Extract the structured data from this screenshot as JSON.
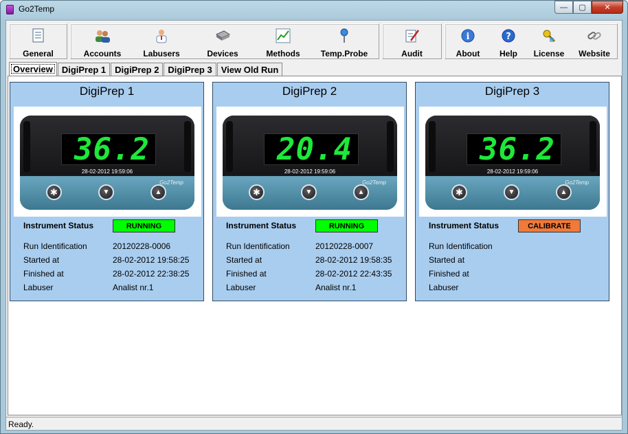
{
  "window": {
    "title": "Go2Temp"
  },
  "window_buttons": {
    "minimize": "—",
    "maximize": "▢",
    "close": "✕"
  },
  "toolbar": {
    "general": "General",
    "accounts": "Accounts",
    "labusers": "Labusers",
    "devices": "Devices",
    "methods": "Methods",
    "temp_probe": "Temp.Probe",
    "audit": "Audit",
    "about": "About",
    "help": "Help",
    "license": "License",
    "website": "Website"
  },
  "tabs": [
    "Overview",
    "DigiPrep 1",
    "DigiPrep 2",
    "DigiPrep 3",
    "View Old Run"
  ],
  "labels": {
    "instrument_status": "Instrument Status",
    "run_identification": "Run Identification",
    "started_at": "Started at",
    "finished_at": "Finished at",
    "labuser": "Labuser"
  },
  "panels": [
    {
      "title": "DigiPrep 1",
      "display_value": "36.2",
      "display_time": "28-02-2012 19:59:06",
      "brand": "Go2Temp",
      "status": "RUNNING",
      "status_color": "#00ff00",
      "run_id": "20120228-0006",
      "started": "28-02-2012 19:58:25",
      "finished": "28-02-2012 22:38:25",
      "labuser": "Analist nr.1"
    },
    {
      "title": "DigiPrep 2",
      "display_value": "20.4",
      "display_time": "28-02-2012 19:59:06",
      "brand": "Go2Temp",
      "status": "RUNNING",
      "status_color": "#00ff00",
      "run_id": "20120228-0007",
      "started": "28-02-2012 19:58:35",
      "finished": "28-02-2012 22:43:35",
      "labuser": "Analist nr.1"
    },
    {
      "title": "DigiPrep 3",
      "display_value": "36.2",
      "display_time": "28-02-2012 19:59:06",
      "brand": "Go2Temp",
      "status": "CALIBRATE",
      "status_color": "#f07a3a",
      "run_id": "",
      "started": "",
      "finished": "",
      "labuser": ""
    }
  ],
  "device_keys": {
    "star": "✱",
    "down": "▼",
    "up": "▲"
  },
  "statusbar": {
    "text": "Ready."
  }
}
